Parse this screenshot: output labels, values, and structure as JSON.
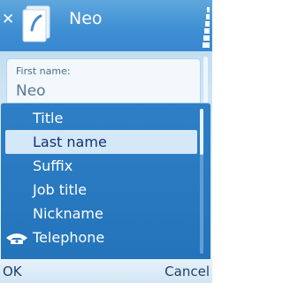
{
  "header": {
    "title": "Neo",
    "icons": [
      "close-icon",
      "contact-card-icon",
      "signal-strength-icon"
    ]
  },
  "form": {
    "field_label": "First name:",
    "field_value": "Neo"
  },
  "popup": {
    "items": [
      {
        "label": "Title",
        "icon": null,
        "selected": false
      },
      {
        "label": "Last name",
        "icon": null,
        "selected": true
      },
      {
        "label": "Suffix",
        "icon": null,
        "selected": false
      },
      {
        "label": "Job title",
        "icon": null,
        "selected": false
      },
      {
        "label": "Nickname",
        "icon": null,
        "selected": false
      },
      {
        "label": "Telephone",
        "icon": "telephone-icon",
        "selected": false
      }
    ]
  },
  "softkeys": {
    "left_label": "OK",
    "right_label": "Cancel"
  },
  "colors": {
    "header": "#3e8ed4",
    "popup": "#2a7ac2",
    "selected_bg": "#d5e8f8",
    "selected_text": "#10357a"
  }
}
